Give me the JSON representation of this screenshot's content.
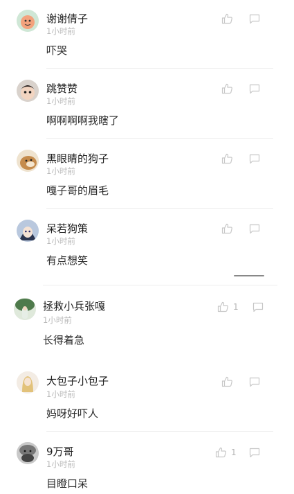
{
  "comments": [
    {
      "name": "谢谢倩子",
      "time": "1小时前",
      "text": "吓哭",
      "likes": ""
    },
    {
      "name": "跳赞赞",
      "time": "1小时前",
      "text": "啊啊啊啊我瞎了",
      "likes": ""
    },
    {
      "name": "黑眼睛的狗子",
      "time": "1小时前",
      "text": "嘎子哥的眉毛",
      "likes": ""
    },
    {
      "name": "呆若狗策",
      "time": "1小时前",
      "text": "有点想笑",
      "likes": ""
    },
    {
      "name": "拯救小兵张嘎",
      "time": "1小时前",
      "text": "长得着急",
      "likes": "1"
    },
    {
      "name": "大包子小包子",
      "time": "1小时前",
      "text": "妈呀好吓人",
      "likes": ""
    },
    {
      "name": "9万哥",
      "time": "1小时前",
      "text": "目瞪口呆",
      "likes": "1"
    }
  ],
  "icons": {
    "like": "thumbs-up-icon",
    "reply": "comment-bubble-icon"
  },
  "colors": {
    "name": "#1f1f1f",
    "time": "#b9b9b9",
    "icon": "#c7c7c7",
    "divider": "#ececec"
  }
}
